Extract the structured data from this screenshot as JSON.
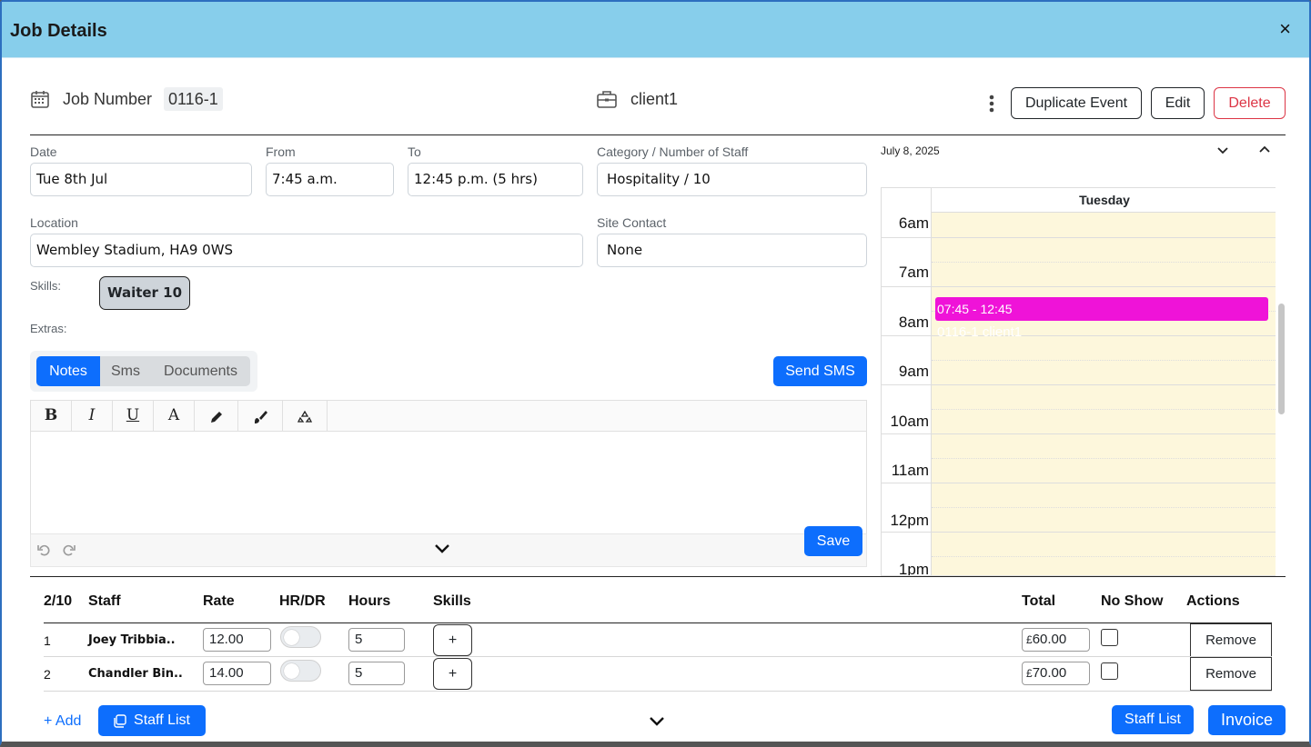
{
  "header": {
    "title": "Job Details",
    "close_label": "×"
  },
  "job": {
    "number_label": "Job Number",
    "number": "0116-1",
    "client": "client1"
  },
  "actions": {
    "duplicate": "Duplicate Event",
    "edit": "Edit",
    "delete": "Delete"
  },
  "form": {
    "date_label": "Date",
    "date_value": "Tue 8th Jul",
    "from_label": "From",
    "from_value": "7:45 a.m.",
    "to_label": "To",
    "to_value": "12:45 p.m. (5 hrs)",
    "category_label": "Category / Number of Staff",
    "category_value": "Hospitality / 10",
    "location_label": "Location",
    "location_value": "Wembley Stadium, HA9 0WS",
    "site_contact_label": "Site Contact",
    "site_contact_value": "None",
    "skills_label": "Skills:",
    "skill_chip": "Waiter 10",
    "extras_label": "Extras:"
  },
  "tabs": {
    "notes": "Notes",
    "sms": "Sms",
    "documents": "Documents",
    "send_sms": "Send SMS"
  },
  "editor": {
    "toolbar": [
      "bold-icon",
      "italic-icon",
      "underline-icon",
      "text-color-icon",
      "pencil-icon",
      "brush-icon",
      "recycle-icon"
    ],
    "bold_glyph": "B",
    "italic_glyph": "I",
    "underline_glyph": "U",
    "color_glyph": "A",
    "save": "Save"
  },
  "calendar": {
    "date": "July 8, 2025",
    "day": "Tuesday",
    "hours": [
      "6am",
      "7am",
      "8am",
      "9am",
      "10am",
      "11am",
      "12pm",
      "1pm"
    ],
    "event_time": "07:45 - 12:45",
    "event_title": "0116-1 client1",
    "event_color": "#ef13d8",
    "day_bg": "#fdf7dc"
  },
  "staff_table": {
    "count": "2/10",
    "headers": {
      "staff": "Staff",
      "rate": "Rate",
      "hrdr": "HR/DR",
      "hours": "Hours",
      "skills": "Skills",
      "total": "Total",
      "no_show": "No Show",
      "actions": "Actions"
    },
    "rows": [
      {
        "num": "1",
        "name": "Joey Tribbia..",
        "rate": "12.00",
        "hrdr": false,
        "hours": "5",
        "add": "+",
        "currency": "£",
        "total": "60.00",
        "no_show": false,
        "remove": "Remove"
      },
      {
        "num": "2",
        "name": "Chandler Bin..",
        "rate": "14.00",
        "hrdr": false,
        "hours": "5",
        "add": "+",
        "currency": "£",
        "total": "70.00",
        "no_show": false,
        "remove": "Remove"
      }
    ]
  },
  "footer": {
    "add": "+ Add",
    "staff_list": "Staff List",
    "staff_list_right": "Staff List",
    "invoice": "Invoice"
  },
  "colors": {
    "header_bg": "#87ceeb",
    "primary": "#0d6efd",
    "danger": "#dc3545"
  }
}
